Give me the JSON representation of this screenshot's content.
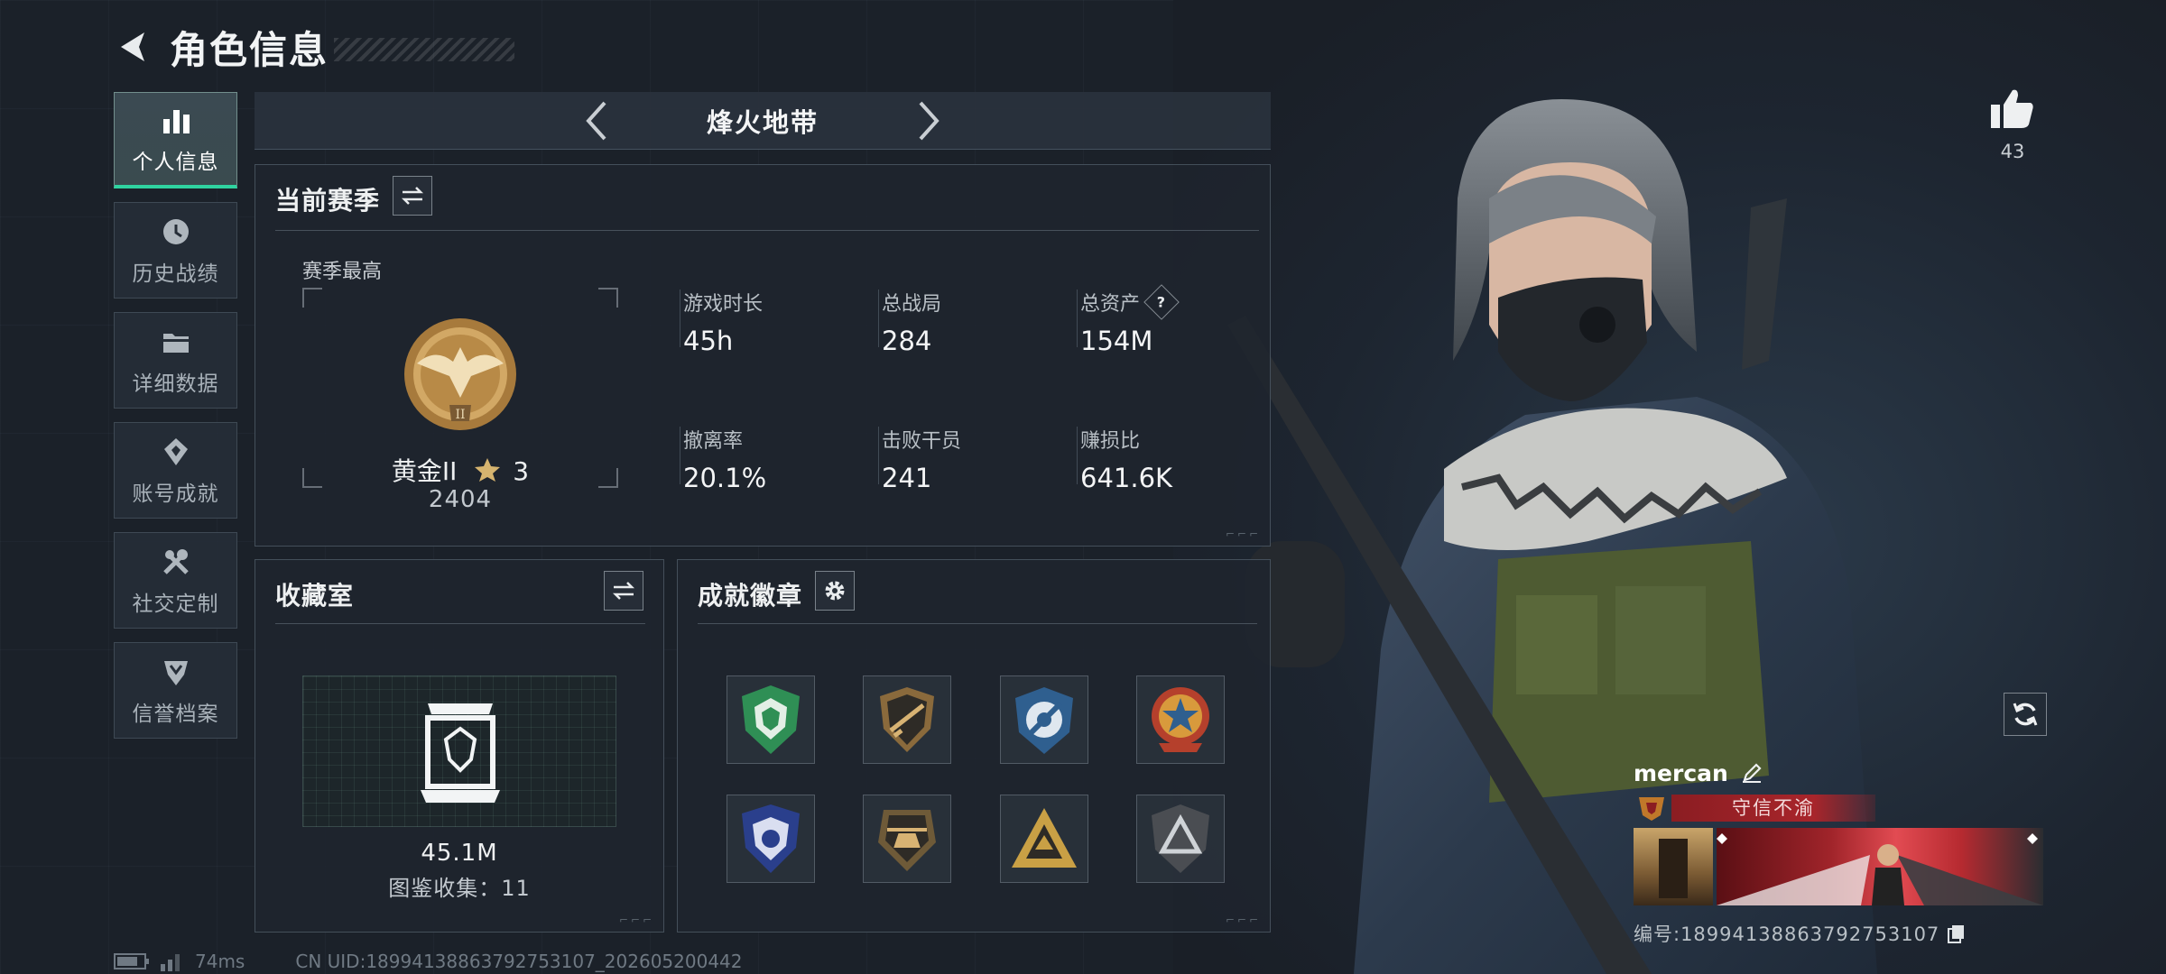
{
  "header": {
    "title": "角色信息"
  },
  "sidebar": {
    "items": [
      {
        "label": "个人信息",
        "icon": "bar-chart-icon",
        "active": true
      },
      {
        "label": "历史战绩",
        "icon": "history-icon",
        "active": false
      },
      {
        "label": "详细数据",
        "icon": "folder-icon",
        "active": false
      },
      {
        "label": "账号成就",
        "icon": "achievement-icon",
        "active": false
      },
      {
        "label": "社交定制",
        "icon": "tools-icon",
        "active": false
      },
      {
        "label": "信誉档案",
        "icon": "credit-shield-icon",
        "active": false
      }
    ]
  },
  "mode": {
    "name": "烽火地带"
  },
  "season": {
    "title": "当前赛季",
    "best_label": "赛季最高",
    "rank_name": "黄金II",
    "rank_stars": "3",
    "rank_score": "2404",
    "stats": [
      {
        "label": "游戏时长",
        "value": "45h"
      },
      {
        "label": "总战局",
        "value": "284"
      },
      {
        "label": "总资产",
        "value": "154M",
        "help": "?"
      },
      {
        "label": "撤离率",
        "value": "20.1%"
      },
      {
        "label": "击败干员",
        "value": "241"
      },
      {
        "label": "赚损比",
        "value": "641.6K"
      }
    ]
  },
  "collection": {
    "title": "收藏室",
    "value": "45.1M",
    "count_text": "图鉴收集：11"
  },
  "achievements": {
    "title": "成就徽章",
    "badges": [
      "green-shield-badge-icon",
      "gold-rifle-badge-icon",
      "blue-emblem-badge-icon",
      "red-star-badge-icon",
      "blue-shield-badge-icon",
      "gold-helicopter-badge-icon",
      "gold-triangle-badge-icon",
      "gray-triangle-badge-icon"
    ]
  },
  "status": {
    "ping": "74ms",
    "uid": "CN UID:18994138863792753107_202605200442"
  },
  "likes": {
    "count": "43"
  },
  "player": {
    "name": "mercan",
    "title": "守信不渝",
    "id_text": "编号:18994138863792753107"
  },
  "colors": {
    "accent": "#2fd3a0",
    "title_red": "#a8252b",
    "background": "#1a1f27"
  }
}
